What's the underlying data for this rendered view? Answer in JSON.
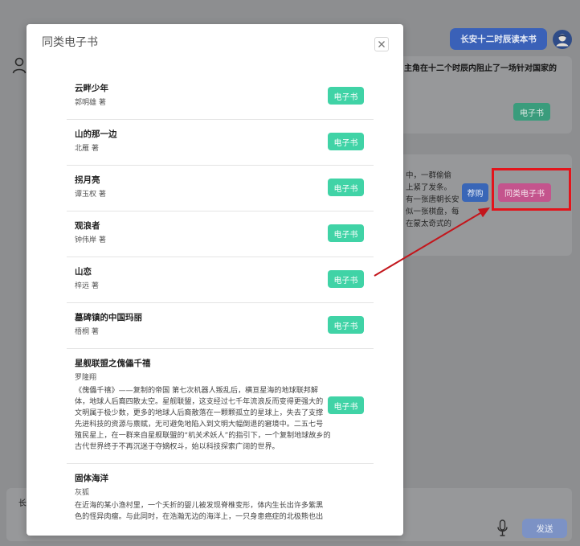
{
  "header": {
    "book_button_label": "长安十二时辰读本书"
  },
  "conversation": {
    "summary_card": {
      "text": "主角在十二个时辰内阻止了一场针对国家的",
      "ebook_button_label": "电子书"
    },
    "book_card": {
      "lines": [
        "中，一群偷偷",
        "上紧了发条。",
        "有一张唐朝长安",
        "似一张棋盘，每",
        "在蒙太奇式的"
      ],
      "recommend_button_label": "荐购",
      "similar_ebooks_button_label": "同类电子书"
    }
  },
  "input_bar": {
    "text": "长",
    "send_button_label": "发送"
  },
  "modal": {
    "title": "同类电子书",
    "item_button_label": "电子书",
    "items": [
      {
        "title": "云畔少年",
        "author": "郭明雄 著"
      },
      {
        "title": "山的那一边",
        "author": "北雁 著"
      },
      {
        "title": "拐月亮",
        "author": "谭玉权 著"
      },
      {
        "title": "观浪者",
        "author": "钟伟岸 著"
      },
      {
        "title": "山恋",
        "author": "梓远 著"
      },
      {
        "title": "墓碑镇的中国玛丽",
        "author": "梧桐 著"
      },
      {
        "title": "星舰联盟之傀儡千禧",
        "author": "罗隆翔",
        "desc_lines": [
          "《傀儡千禧》——复制的帝国 第七次机器人叛乱后，横亘星海的地球联邦解",
          "体，地球人后裔四散太空。星舰联盟，这支经过七千年流浪反而变得更强大的",
          "文明属于极少数，更多的地球人后裔散落在一颗颗孤立的星球上，失去了支撑",
          "先进科技的资源与禀赋，无可避免地陷入到文明大幅倒退的窘境中。二五七号",
          "殖民星上，在一群来自星舰联盟的“机关术妖人”的指引下，一个复制地球故乡的",
          "古代世界终于不再沉迷于夺嫡权斗，始以科技探索广阔的世界。"
        ]
      },
      {
        "title": "固体海洋",
        "author": "灰狐",
        "desc_lines": [
          "在近海的某小渔村里，一个夭折的婴儿被发现脊椎变形，体内生长出许多紫黑",
          "色的怪异肉瘤。与此同时，在浩瀚无边的海洋上，一只身患癌症的北极熊也出"
        ]
      }
    ]
  },
  "icons": {
    "top_avatar": "user-avatar-icon",
    "chat_avatar": "chat-avatar-icon",
    "close": "close-icon",
    "mic": "mic-icon"
  },
  "colors": {
    "header_button": "#3a61b8",
    "ebook_button_background": "#3a9c7c",
    "recommend_button": "#3966b7",
    "similar_ebooks_button": "#c4548d",
    "send_button": "#7c92c5",
    "modal_ebook_button": "#40d3a6",
    "annotation_box": "#e3141b",
    "annotation_arrow": "#c3161c"
  }
}
